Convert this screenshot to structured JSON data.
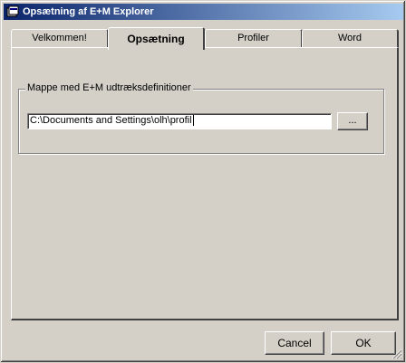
{
  "window": {
    "title": "Opsætning af E+M Explorer",
    "icon": "app-icon"
  },
  "tabs": [
    {
      "label": "Velkommen!",
      "active": false
    },
    {
      "label": "Opsætning",
      "active": true
    },
    {
      "label": "Profiler",
      "active": false
    },
    {
      "label": "Word",
      "active": false
    }
  ],
  "settings": {
    "group_label": "Mappe med E+M udtræksdefinitioner",
    "folder_path": "C:\\Documents and Settings\\olh\\profil",
    "browse_label": "..."
  },
  "buttons": {
    "cancel_label": "Cancel",
    "ok_label": "OK"
  },
  "colors": {
    "title_bar_start": "#0a246a",
    "title_bar_end": "#a6caf0",
    "face": "#d4d0c8"
  }
}
